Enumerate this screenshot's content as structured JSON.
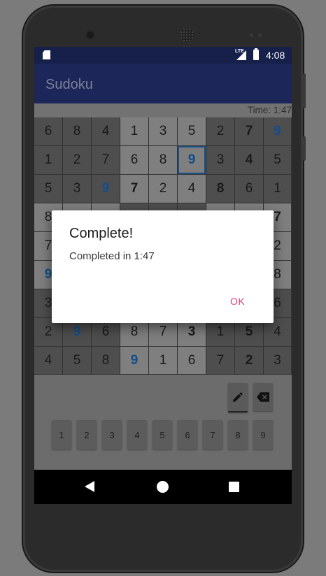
{
  "status_bar": {
    "network": "LTE",
    "time": "4:08",
    "icons": [
      "sd-card-icon",
      "signal-icon",
      "battery-charging-icon"
    ]
  },
  "app_bar": {
    "title": "Sudoku"
  },
  "timer": {
    "text": "Time: 1:47"
  },
  "board": {
    "rows": [
      [
        "6",
        "8",
        "4",
        "1",
        "3",
        "5",
        "2",
        "7",
        "9"
      ],
      [
        "1",
        "2",
        "7",
        "6",
        "8",
        "9",
        "3",
        "4",
        "5"
      ],
      [
        "5",
        "3",
        "9",
        "7",
        "2",
        "4",
        "8",
        "6",
        "1"
      ],
      [
        "8",
        "",
        "",
        "",
        "",
        "",
        "",
        "",
        "7"
      ],
      [
        "7",
        "",
        "",
        "",
        "",
        "",
        "",
        "",
        "2"
      ],
      [
        "9",
        "",
        "",
        "",
        "",
        "",
        "",
        "",
        "8"
      ],
      [
        "3",
        "",
        "",
        "",
        "",
        "",
        "",
        "",
        "6"
      ],
      [
        "2",
        "9",
        "6",
        "8",
        "7",
        "3",
        "1",
        "5",
        "4"
      ],
      [
        "4",
        "5",
        "8",
        "9",
        "1",
        "6",
        "7",
        "2",
        "3"
      ]
    ],
    "given": [
      [
        false,
        false,
        false,
        false,
        false,
        false,
        false,
        true,
        false
      ],
      [
        false,
        false,
        false,
        false,
        false,
        false,
        false,
        true,
        false
      ],
      [
        false,
        false,
        false,
        true,
        false,
        false,
        true,
        false,
        false
      ],
      [
        false,
        false,
        false,
        false,
        false,
        false,
        false,
        false,
        true
      ],
      [
        false,
        false,
        false,
        false,
        false,
        false,
        false,
        false,
        false
      ],
      [
        false,
        false,
        false,
        false,
        false,
        false,
        false,
        false,
        false
      ],
      [
        false,
        false,
        false,
        false,
        false,
        false,
        false,
        false,
        false
      ],
      [
        false,
        false,
        false,
        false,
        false,
        true,
        false,
        true,
        false
      ],
      [
        false,
        false,
        false,
        false,
        false,
        false,
        false,
        true,
        false
      ]
    ],
    "user_entered": [
      [
        false,
        false,
        false,
        false,
        false,
        false,
        false,
        false,
        true
      ],
      [
        false,
        false,
        false,
        false,
        false,
        true,
        false,
        false,
        false
      ],
      [
        false,
        false,
        true,
        false,
        false,
        false,
        false,
        false,
        false
      ],
      [
        false,
        false,
        false,
        false,
        false,
        false,
        false,
        false,
        false
      ],
      [
        false,
        false,
        false,
        false,
        false,
        false,
        false,
        false,
        false
      ],
      [
        true,
        false,
        false,
        false,
        false,
        false,
        false,
        false,
        false
      ],
      [
        false,
        false,
        false,
        false,
        false,
        false,
        false,
        false,
        false
      ],
      [
        false,
        true,
        false,
        false,
        false,
        false,
        false,
        false,
        false
      ],
      [
        false,
        false,
        false,
        true,
        false,
        false,
        false,
        false,
        false
      ]
    ],
    "selected_cell": [
      1,
      5
    ]
  },
  "keypad": {
    "tools": [
      {
        "name": "pencil-icon"
      },
      {
        "name": "backspace-icon"
      }
    ],
    "numbers": [
      "1",
      "2",
      "3",
      "4",
      "5",
      "6",
      "7",
      "8",
      "9"
    ]
  },
  "dialog": {
    "title": "Complete!",
    "message": "Completed in 1:47",
    "ok_label": "OK"
  },
  "colors": {
    "app_bar": "#1c2659",
    "status_bar": "#16204a",
    "user_digit": "#124e8a",
    "dialog_button": "#e0407c"
  }
}
